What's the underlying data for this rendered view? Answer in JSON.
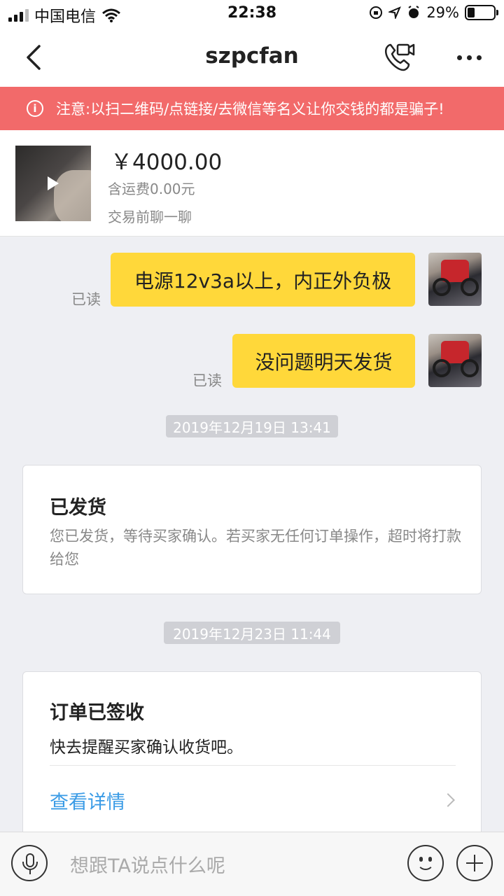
{
  "status_bar": {
    "carrier": "中国电信",
    "time": "22:38",
    "battery": "29%",
    "battery_level": 0.29,
    "icons": [
      "signal-icon",
      "wifi-icon",
      "orientation-lock-icon",
      "location-icon",
      "alarm-icon",
      "battery-icon"
    ]
  },
  "nav": {
    "title": "szpcfan",
    "back_icon": "chevron-left-icon",
    "call_icon": "phone-video-icon",
    "more_icon": "more-dots-icon"
  },
  "warning": {
    "text": "注意:以扫二维码/点链接/去微信等名义让你交钱的都是骗子!",
    "icon": "info-icon",
    "color": "#f26a6a"
  },
  "product": {
    "price": "￥4000.00",
    "shipping": "含运费0.00元",
    "chat_prompt": "交易前聊一聊"
  },
  "messages": [
    {
      "read_label": "已读",
      "text": "电源12v3a以上，内正外负极"
    },
    {
      "read_label": "已读",
      "text": "没问题明天发货"
    }
  ],
  "timestamps": [
    "2019年12月19日 13:41",
    "2019年12月23日 11:44"
  ],
  "shipped_card": {
    "title": "已发货",
    "desc": "您已发货，等待买家确认。若买家无任何订单操作，超时将打款给您"
  },
  "signed_card": {
    "title": "订单已签收",
    "text": "快去提醒买家确认收货吧。",
    "link": "查看详情"
  },
  "input_bar": {
    "placeholder": "想跟TA说点什么呢",
    "icons": [
      "microphone-icon",
      "emoji-icon",
      "plus-icon"
    ]
  },
  "colors": {
    "bubble": "#ffd83a",
    "link": "#3a9be6",
    "background": "#eeeff3"
  }
}
